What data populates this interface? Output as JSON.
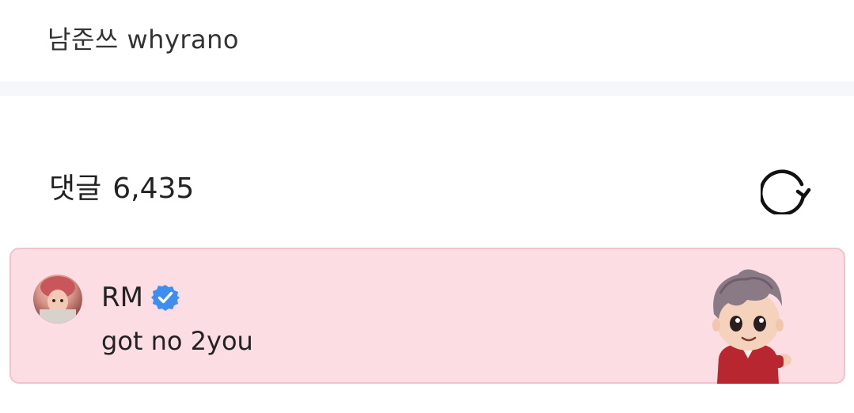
{
  "top": {
    "text": "남준쓰 whyrano"
  },
  "comments": {
    "label": "댓글",
    "count": "6,435",
    "refresh_icon": "refresh-icon"
  },
  "pinned_comment": {
    "author": "RM",
    "verified_icon": "verified-badge-icon",
    "text": "got no 2you",
    "sticker": "tinytan-rm-sticker"
  },
  "colors": {
    "card_bg": "#fbdde3",
    "card_border": "#f0c2cc",
    "verified": "#3d8ef0",
    "divider": "#f4f6f9"
  }
}
